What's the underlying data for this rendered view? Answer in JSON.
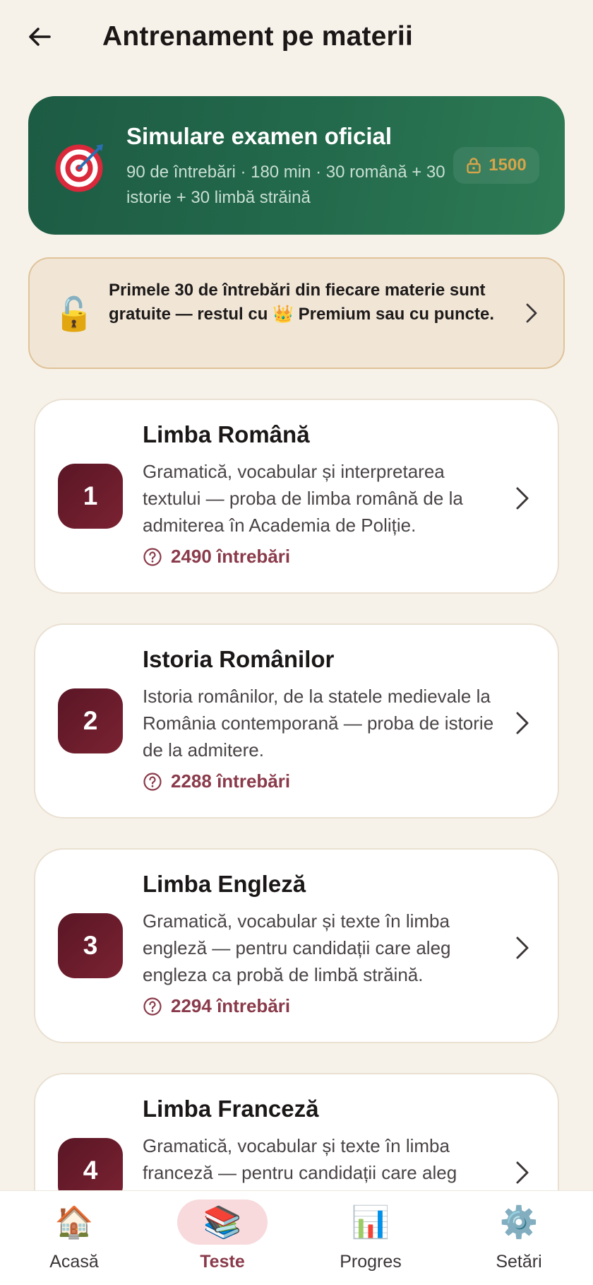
{
  "header": {
    "title": "Antrenament pe materii",
    "back_icon": "arrow-left-icon"
  },
  "exam": {
    "icon": "🎯",
    "title": "Simulare examen oficial",
    "description": "90 de întrebări · 180 min · 30 română + 30 istorie + 30 limbă străină",
    "cost": "1500",
    "cost_icon": "lock-icon"
  },
  "info": {
    "icon": "🔓",
    "text": "Primele 30 de întrebări din fiecare materie sunt gratuite — restul cu 👑 Premium sau cu puncte."
  },
  "subjects": [
    {
      "number": "1",
      "title": "Limba Română",
      "description": "Gramatică, vocabular și interpretarea textului — proba de limba română de la admiterea în Academia de Poliție.",
      "count": "2490 întrebări"
    },
    {
      "number": "2",
      "title": "Istoria Românilor",
      "description": "Istoria românilor, de la statele medievale la România contemporană — proba de istorie de la admitere.",
      "count": "2288 întrebări"
    },
    {
      "number": "3",
      "title": "Limba Engleză",
      "description": "Gramatică, vocabular și texte în limba engleză — pentru candidații care aleg engleza ca probă de limbă străină.",
      "count": "2294 întrebări"
    },
    {
      "number": "4",
      "title": "Limba Franceză",
      "description": "Gramatică, vocabular și texte în limba franceză — pentru candidații care aleg franceza ca probă de limbă străină.",
      "count": ""
    }
  ],
  "nav": [
    {
      "icon": "🏠",
      "label": "Acasă"
    },
    {
      "icon": "📚",
      "label": "Teste"
    },
    {
      "icon": "📊",
      "label": "Progres"
    },
    {
      "icon": "⚙️",
      "label": "Setări"
    }
  ],
  "colors": {
    "background": "#f7f2e9",
    "exam_green": "#236a4c",
    "accent_burgundy": "#8a3a4a",
    "badge_gold": "#d7a44a"
  }
}
